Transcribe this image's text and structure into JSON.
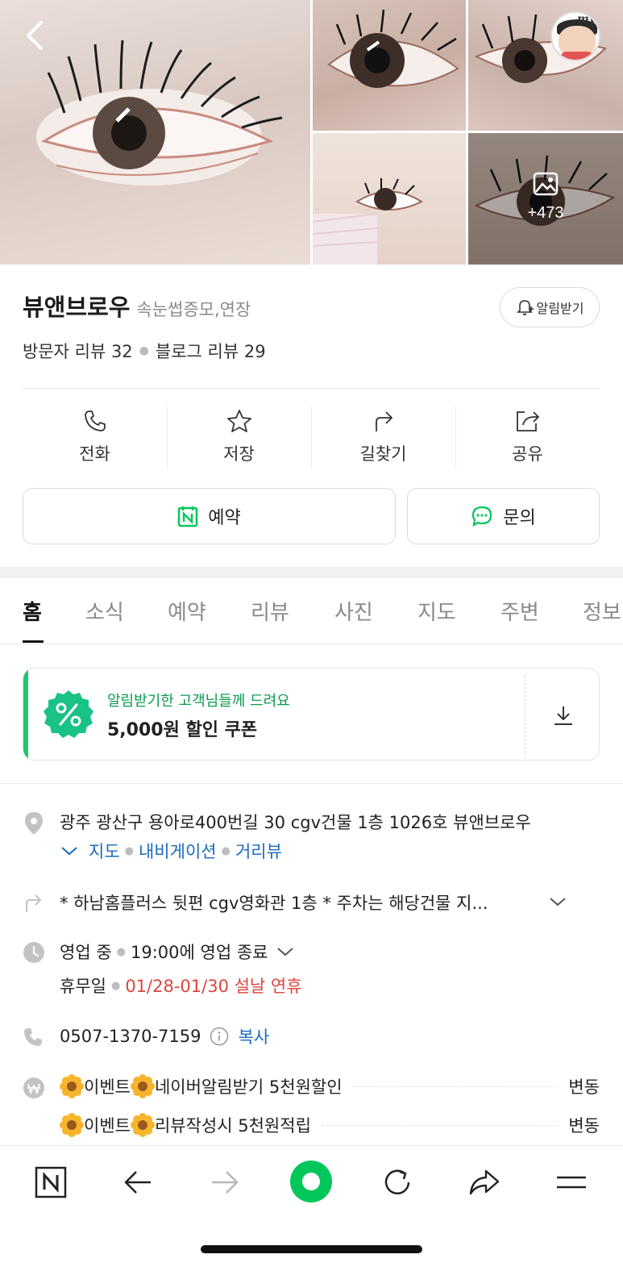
{
  "photos": {
    "more_count": "+473"
  },
  "header": {
    "name": "뷰앤브로우",
    "category": "속눈썹증모,연장",
    "notify_label": "알림받기",
    "visitor_reviews": "방문자 리뷰 32",
    "blog_reviews": "블로그 리뷰 29"
  },
  "actions": [
    {
      "label": "전화",
      "icon": "phone-icon"
    },
    {
      "label": "저장",
      "icon": "star-icon"
    },
    {
      "label": "길찾기",
      "icon": "directions-icon"
    },
    {
      "label": "공유",
      "icon": "share-icon"
    }
  ],
  "buttons": {
    "reserve": "예약",
    "inquiry": "문의"
  },
  "tabs": [
    "홈",
    "소식",
    "예약",
    "리뷰",
    "사진",
    "지도",
    "주변",
    "정보"
  ],
  "active_tab": "홈",
  "coupon": {
    "sub": "알림받기한 고객님들께 드려요",
    "main": "5,000원 할인 쿠폰"
  },
  "info": {
    "address": "광주 광산구 용아로400번길 30 cgv건물 1층 1026호 뷰앤브로우",
    "address_links": [
      "지도",
      "내비게이션",
      "거리뷰"
    ],
    "directions": "* 하남홈플러스 뒷편 cgv영화관 1층 * 주차는 해당건물 지...",
    "hours_status": "영업 중",
    "hours_detail": "19:00에 영업 종료",
    "holiday_label": "휴무일",
    "holiday_value": "01/28-01/30 설날 연휴",
    "phone": "0507-1370-7159",
    "copy_label": "복사",
    "prices": [
      {
        "pre": "이벤트",
        "name": "네이버알림받기 5천원할인",
        "value": "변동"
      },
      {
        "pre": "이벤트",
        "name": "리뷰작성시 5천원적립",
        "value": "변동"
      }
    ]
  },
  "colors": {
    "naver_green": "#03c75a",
    "link_blue": "#1a6bbf",
    "holiday_red": "#e0443e"
  }
}
